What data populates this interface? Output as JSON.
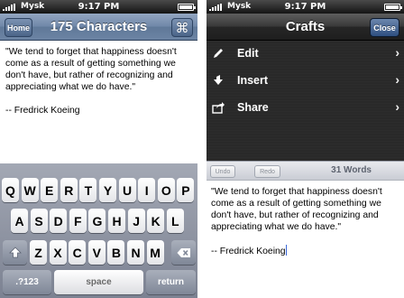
{
  "status": {
    "carrier": "Mysk",
    "time": "9:17 PM"
  },
  "left": {
    "nav": {
      "title": "175 Characters",
      "home_label": "Home",
      "cmd_label": "⌘"
    },
    "document": "\"We tend to forget that happiness doesn't come as a result of getting something we don't have, but rather of recognizing and appreciating what we do have.\"\n\n-- Fredrick Koeing",
    "keyboard": {
      "row1": [
        "Q",
        "W",
        "E",
        "R",
        "T",
        "Y",
        "U",
        "I",
        "O",
        "P"
      ],
      "row2": [
        "A",
        "S",
        "D",
        "F",
        "G",
        "H",
        "J",
        "K",
        "L"
      ],
      "row3": [
        "Z",
        "X",
        "C",
        "V",
        "B",
        "N",
        "M"
      ],
      "shift_icon": "shift-icon",
      "backspace_icon": "backspace-icon",
      "numbers_label": ".?123",
      "space_label": "space",
      "return_label": "return"
    }
  },
  "right": {
    "nav": {
      "title": "Crafts",
      "close_label": "Close"
    },
    "menu": [
      {
        "label": "Edit",
        "icon": "pencil-icon"
      },
      {
        "label": "Insert",
        "icon": "insert-arrow-icon"
      },
      {
        "label": "Share",
        "icon": "share-icon"
      }
    ],
    "toolbar": {
      "undo_label": "Undo",
      "redo_label": "Redo",
      "word_count": "31 Words"
    },
    "document": "\"We tend to forget that happiness doesn't come as a result of getting something we don't have, but rather of recognizing and appreciating what we do have.\"\n\n-- Fredrick Koeing"
  }
}
